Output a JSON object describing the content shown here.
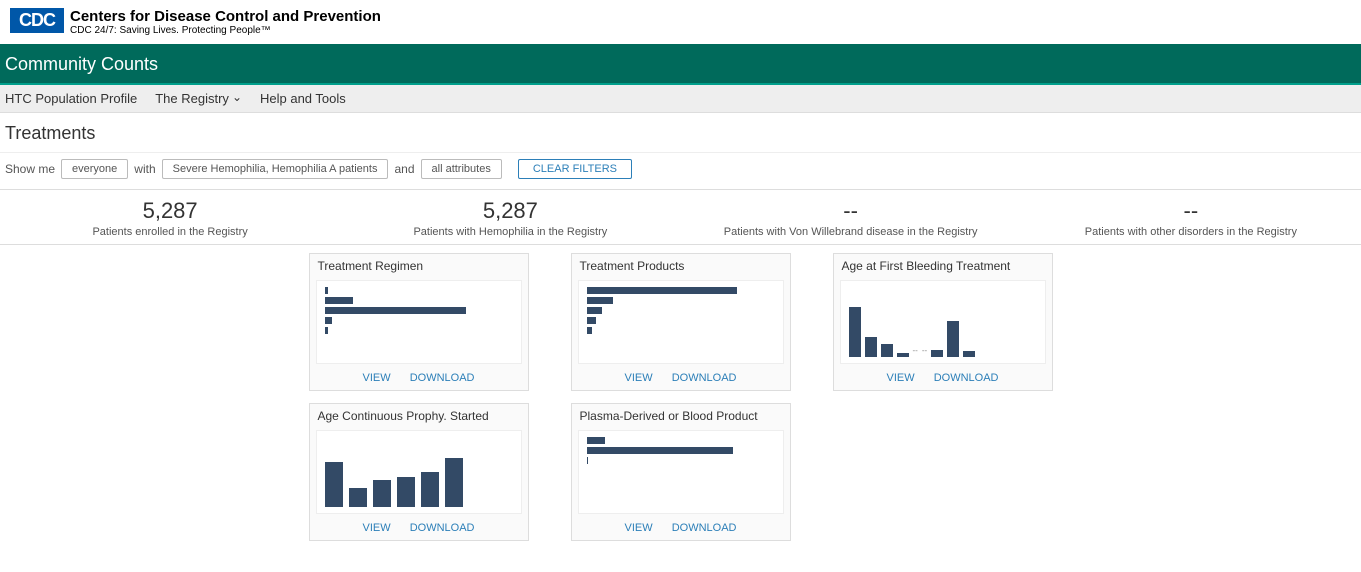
{
  "header": {
    "logo_abbr": "CDC",
    "title": "Centers for Disease Control and Prevention",
    "subtitle": "CDC 24/7: Saving Lives. Protecting People™"
  },
  "greenbar": {
    "title": "Community Counts"
  },
  "nav": {
    "item1": "HTC Population Profile",
    "item2": "The Registry",
    "item3": "Help and Tools"
  },
  "page": {
    "title": "Treatments"
  },
  "filters": {
    "label_showme": "Show me",
    "pill_everyone": "everyone",
    "label_with": "with",
    "pill_condition": "Severe Hemophilia, Hemophilia A patients",
    "label_and": "and",
    "pill_attributes": "all attributes",
    "clear_label": "CLEAR FILTERS"
  },
  "stats": [
    {
      "value": "5,287",
      "label": "Patients enrolled in the Registry"
    },
    {
      "value": "5,287",
      "label": "Patients with Hemophilia in the Registry"
    },
    {
      "value": "--",
      "label": "Patients with Von Willebrand disease in the Registry"
    },
    {
      "value": "--",
      "label": "Patients with other disorders in the Registry"
    }
  ],
  "cards": {
    "c0": {
      "title": "Treatment Regimen",
      "view": "VIEW",
      "download": "DOWNLOAD"
    },
    "c1": {
      "title": "Treatment Products",
      "view": "VIEW",
      "download": "DOWNLOAD"
    },
    "c2": {
      "title": "Age at First Bleeding Treatment",
      "view": "VIEW",
      "download": "DOWNLOAD"
    },
    "c3": {
      "title": "Age Continuous Prophy. Started",
      "view": "VIEW",
      "download": "DOWNLOAD"
    },
    "c4": {
      "title": "Plasma-Derived or Blood Product",
      "view": "VIEW",
      "download": "DOWNLOAD"
    }
  },
  "chart_data": [
    {
      "id": "c0",
      "title": "Treatment Regimen",
      "type": "bar",
      "orientation": "horizontal",
      "values": [
        2,
        15,
        75,
        4,
        2
      ]
    },
    {
      "id": "c1",
      "title": "Treatment Products",
      "type": "bar",
      "orientation": "horizontal",
      "values": [
        80,
        14,
        8,
        5,
        3
      ]
    },
    {
      "id": "c2",
      "title": "Age at First Bleeding Treatment",
      "type": "bar",
      "orientation": "vertical",
      "values": [
        70,
        28,
        18,
        6,
        0,
        0,
        10,
        50,
        8
      ]
    },
    {
      "id": "c3",
      "title": "Age Continuous Prophy. Started",
      "type": "bar",
      "orientation": "vertical",
      "values": [
        62,
        27,
        37,
        42,
        48,
        68
      ]
    },
    {
      "id": "c4",
      "title": "Plasma-Derived or Blood Product",
      "type": "bar",
      "orientation": "horizontal",
      "values": [
        10,
        78,
        1
      ]
    }
  ]
}
